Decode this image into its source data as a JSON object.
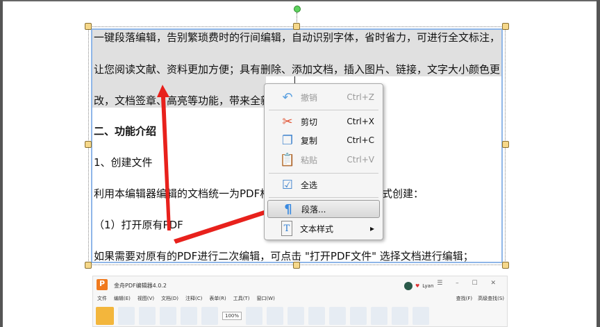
{
  "document": {
    "lines": [
      "一键段落编辑，告别繁琐费时的行间编辑，自动识别字体，省时省力，可进行全文标注，",
      "让您阅读文献、资料更加方便；具有删除、添加文档，插入图片、链接，文字大小颜色更",
      "改，文档签章、高亮等功能，带来全新",
      "二、功能介绍",
      "1、创建文件",
      "利用本编辑器编辑的文档统一为PDF格",
      "式创建：",
      "（1）打开原有PDF",
      "如果需要对原有的PDF进行二次编辑，可点击 \"打开PDF文件\" 选择文档进行编辑；"
    ]
  },
  "context_menu": {
    "items": [
      {
        "label": "撤销",
        "shortcut": "Ctrl+Z",
        "icon": "undo-icon",
        "disabled": true
      },
      {
        "label": "剪切",
        "shortcut": "Ctrl+X",
        "icon": "scissors-icon"
      },
      {
        "label": "复制",
        "shortcut": "Ctrl+C",
        "icon": "copy-icon"
      },
      {
        "label": "粘贴",
        "shortcut": "Ctrl+V",
        "icon": "paste-icon",
        "disabled": true
      },
      {
        "label": "全选",
        "icon": "select-all-icon"
      },
      {
        "label": "段落...",
        "icon": "paragraph-icon",
        "highlighted": true
      },
      {
        "label": "文本样式",
        "icon": "text-style-icon",
        "submenu": "▸"
      }
    ]
  },
  "app": {
    "logo": "P",
    "title": "金舟PDF编辑器4.0.2",
    "user": "Lyan",
    "window_controls": "☰ – ☐ ✕",
    "menus": [
      "文件",
      "编辑(E)",
      "视图(V)",
      "文档(D)",
      "注释(C)",
      "表单(R)",
      "工具(T)",
      "窗口(W)"
    ],
    "find": "查找(F)",
    "advanced_find": "高级查找(S)",
    "zoom": "100%"
  },
  "colors": {
    "accent": "#8fb6e8",
    "arrow": "#e8211c",
    "highlight": "#e0e0e0"
  }
}
